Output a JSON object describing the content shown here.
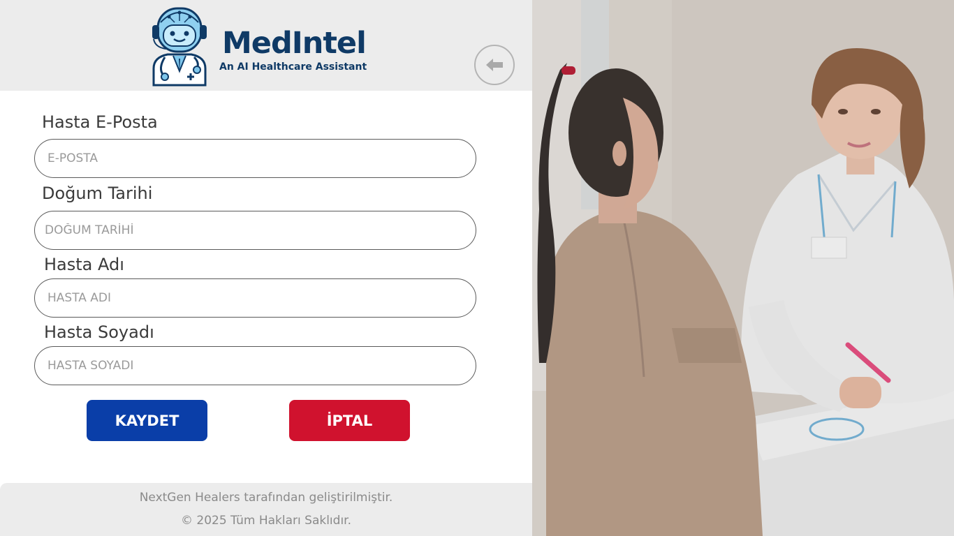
{
  "brand": {
    "name": "MedIntel",
    "tagline": "An AI Healthcare Assistant"
  },
  "header": {
    "back_icon": "arrow-left-icon"
  },
  "form": {
    "email": {
      "label": "Hasta E-Posta",
      "placeholder": "E-POSTA",
      "value": ""
    },
    "birthdate": {
      "label": "Doğum Tarihi",
      "placeholder": "DOĞUM TARİHİ",
      "value": ""
    },
    "first_name": {
      "label": "Hasta Adı",
      "placeholder": "HASTA ADI",
      "value": ""
    },
    "last_name": {
      "label": "Hasta Soyadı",
      "placeholder": "HASTA SOYADI",
      "value": ""
    }
  },
  "actions": {
    "save_label": "KAYDET",
    "cancel_label": "İPTAL"
  },
  "footer": {
    "line1": "NextGen Healers tarafından geliştirilmiştir.",
    "line2": "© 2025 Tüm Hakları Saklıdır."
  },
  "colors": {
    "brand_navy": "#0f3a66",
    "save": "#0a3ea8",
    "cancel": "#d0122e",
    "panel_gray": "#ececec"
  }
}
